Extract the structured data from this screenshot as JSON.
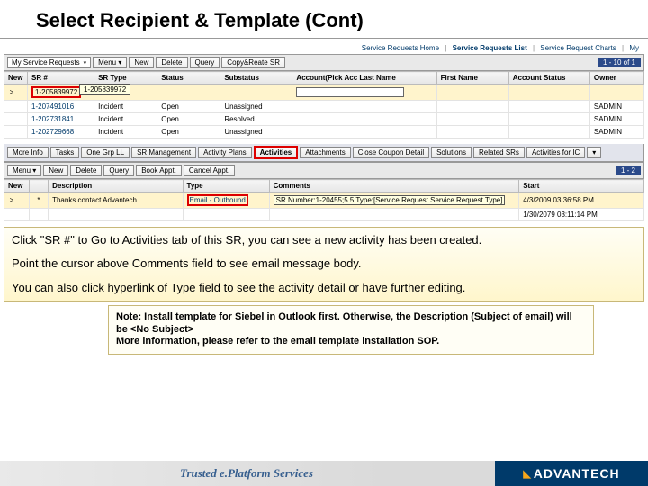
{
  "title": "Select Recipient & Template (Cont)",
  "nav": {
    "home": "Service Requests Home",
    "list": "Service Requests List",
    "charts": "Service Request Charts",
    "my": "My"
  },
  "topToolbar": {
    "applet": "My Service Requests",
    "menu": "Menu ▾",
    "new": "New",
    "delete": "Delete",
    "query": "Query",
    "copy": "Copy&Reate SR",
    "pager": "1 - 10 of 1"
  },
  "srCols": [
    "New",
    "SR #",
    "SR Type",
    "Status",
    "Substatus",
    "Account(Pick Acc Last Name",
    "First Name",
    "Account Status",
    "Owner"
  ],
  "srRows": [
    {
      "new": ">",
      "sr": "1-205839972",
      "type": "",
      "status": "",
      "sub": "",
      "acct": "",
      "first": "",
      "astatus": "",
      "owner": ""
    },
    {
      "new": "",
      "sr": "1-207491016",
      "type": "Incident",
      "status": "Open",
      "sub": "Unassigned",
      "acct": "",
      "first": "",
      "astatus": "",
      "owner": "SADMIN"
    },
    {
      "new": "",
      "sr": "1-202731841",
      "type": "Incident",
      "status": "Open",
      "sub": "Resolved",
      "acct": "",
      "first": "",
      "astatus": "",
      "owner": "SADMIN"
    },
    {
      "new": "",
      "sr": "1-202729668",
      "type": "Incident",
      "status": "Open",
      "sub": "Unassigned",
      "acct": "",
      "first": "",
      "astatus": "",
      "owner": "SADMIN"
    }
  ],
  "tooltip": "1-205839972",
  "tabs": [
    "More Info",
    "Tasks",
    "One Grp LL",
    "SR Management",
    "Activity Plans",
    "Activities",
    "Attachments",
    "Close Coupon Detail",
    "Solutions",
    "Related SRs",
    "Activities for IC"
  ],
  "actToolbar": {
    "menu": "Menu ▾",
    "new": "New",
    "delete": "Delete",
    "query": "Query",
    "book": "Book Appt.",
    "cancel": "Cancel Appt.",
    "pager": "1 - 2"
  },
  "actCols": [
    "New",
    "",
    "Description",
    "Type",
    "Comments",
    "Start"
  ],
  "actRows": [
    {
      "sel": ">",
      "star": "*",
      "desc": "Thanks contact Advantech",
      "type": "Email - Outbound",
      "comments": "SR Number:1-20455;5.5 Type:[Service Request.Service Request Type]",
      "start": "4/3/2009 03:36:58 PM"
    },
    {
      "sel": "",
      "star": "",
      "desc": "",
      "type": "",
      "comments": "",
      "start": "1/30/2079 03:11:14 PM"
    }
  ],
  "instructions": {
    "p1": "Click \"SR #\" to Go to Activities tab of this SR, you can see a new activity has been created.",
    "p2": "Point the cursor above Comments field to see email message body.",
    "p3": "You can also click hyperlink of Type field to see the activity detail or have further editing."
  },
  "note": {
    "l1": "Note: Install template for Siebel in Outlook first. Otherwise, the Description (Subject of email) will be <No Subject>",
    "l2": "More information, please refer to the email template installation SOP."
  },
  "footer": {
    "slogan": "Trusted e.Platform Services",
    "brand": "ADVANTECH"
  }
}
